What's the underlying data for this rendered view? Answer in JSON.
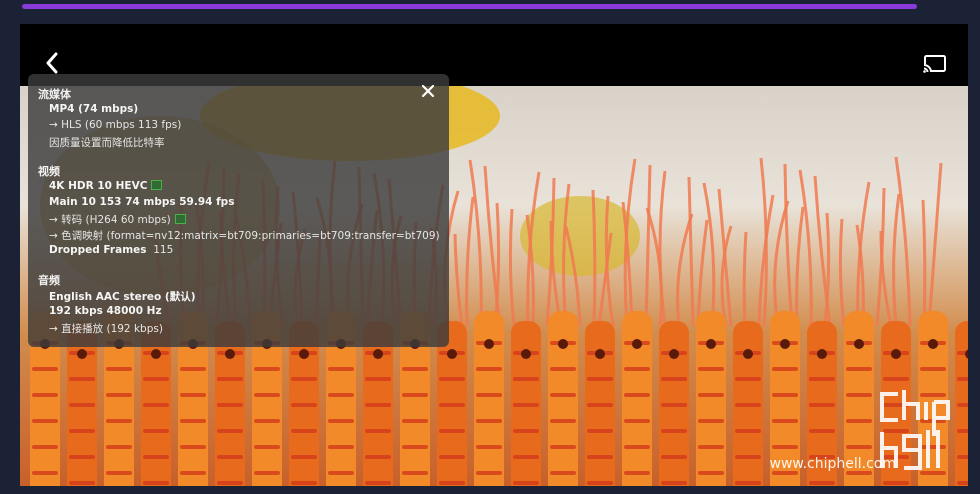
{
  "progress": {
    "fraction": 0.94
  },
  "header": {
    "back_icon": "chevron-left-icon",
    "cast_icon": "cast-icon"
  },
  "stats": {
    "close_icon": "close-icon",
    "streaming": {
      "title": "流媒体",
      "container": "MP4 (74 mbps)",
      "hls": "→ HLS (60 mbps 113 fps)",
      "reason": "因质量设置而降低比特率"
    },
    "video": {
      "title": "视频",
      "codec": "4K HDR 10 HEVC",
      "profile": "Main 10 153 74 mbps 59.94 fps",
      "transcode": "→ 转码 (H264 60 mbps)",
      "tonemap_label": "→ 色调映射",
      "tonemap_value": "(format=nv12:matrix=bt709:primaries=bt709:transfer=bt709)",
      "dropped_label": "Dropped Frames",
      "dropped_value": "115"
    },
    "audio": {
      "title": "音频",
      "track": "English AAC stereo (默认)",
      "rate": "192 kbps 48000 Hz",
      "direct": "→ 直接播放 (192 kbps)"
    }
  },
  "watermark": {
    "text": "www.chiphell.com",
    "logo_text": "chip hell"
  }
}
